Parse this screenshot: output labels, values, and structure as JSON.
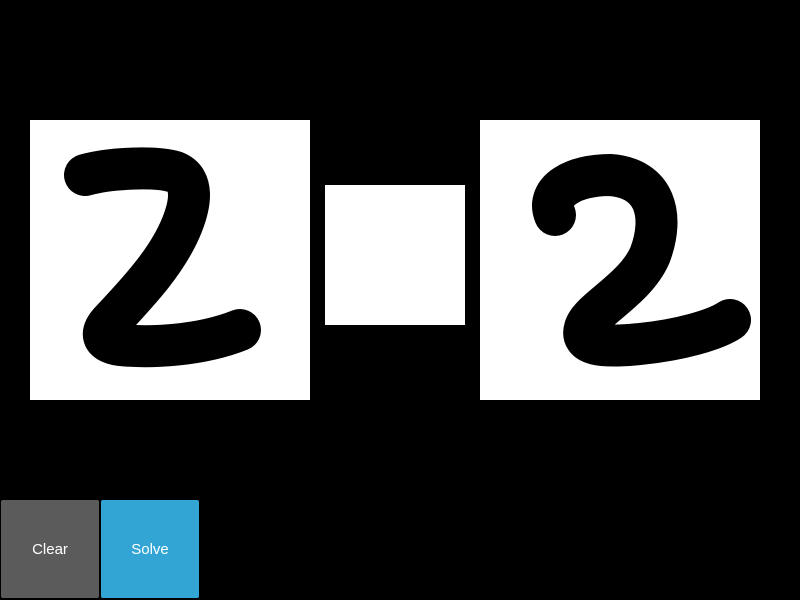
{
  "canvases": {
    "left_operand": {
      "drawn_glyph": "2",
      "ink_color": "#000000",
      "paper_color": "#ffffff"
    },
    "operator": {
      "drawn_glyph": "",
      "ink_color": "#000000",
      "paper_color": "#ffffff"
    },
    "right_operand": {
      "drawn_glyph": "2",
      "ink_color": "#000000",
      "paper_color": "#ffffff"
    }
  },
  "buttons": {
    "clear": {
      "label": "Clear",
      "color": "#5b5b5b"
    },
    "solve": {
      "label": "Solve",
      "color": "#33a5d4"
    }
  },
  "colors": {
    "background": "#000000"
  }
}
